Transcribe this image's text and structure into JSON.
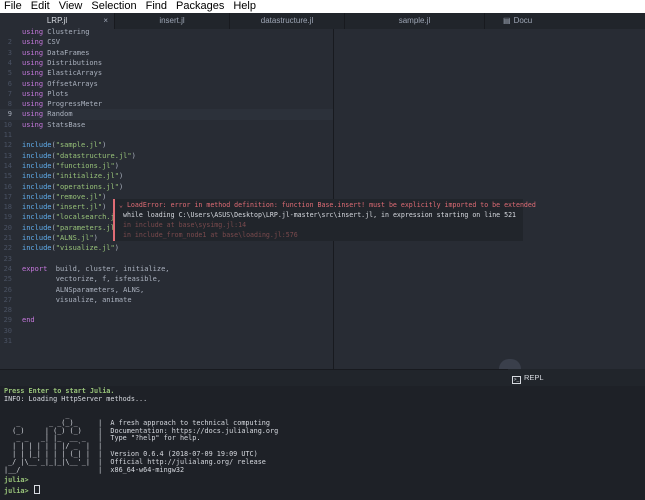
{
  "menu": [
    "File",
    "Edit",
    "View",
    "Selection",
    "Find",
    "Packages",
    "Help"
  ],
  "tabs": [
    {
      "label": "LRP.jl",
      "active": true
    },
    {
      "label": "insert.jl",
      "active": false
    },
    {
      "label": "datastructure.jl",
      "active": false
    },
    {
      "label": "sample.jl",
      "active": false
    },
    {
      "label": "Docu",
      "active": false
    }
  ],
  "close_glyph": "×",
  "editor": {
    "current_line": 9,
    "lines": [
      {
        "n": "",
        "kw": "using",
        "rest": " Clustering"
      },
      {
        "n": "2",
        "kw": "using",
        "rest": " CSV"
      },
      {
        "n": "3",
        "kw": "using",
        "rest": " DataFrames"
      },
      {
        "n": "4",
        "kw": "using",
        "rest": " Distributions"
      },
      {
        "n": "5",
        "kw": "using",
        "rest": " ElasticArrays"
      },
      {
        "n": "6",
        "kw": "using",
        "rest": " OffsetArrays"
      },
      {
        "n": "7",
        "kw": "using",
        "rest": " Plots"
      },
      {
        "n": "8",
        "kw": "using",
        "rest": " ProgressMeter"
      },
      {
        "n": "9",
        "kw": "using",
        "rest": " Random"
      },
      {
        "n": "10",
        "kw": "using",
        "rest": " StatsBase"
      },
      {
        "n": "11",
        "kw": "",
        "rest": ""
      },
      {
        "n": "12",
        "fn": "include",
        "str": "\"sample.jl\""
      },
      {
        "n": "13",
        "fn": "include",
        "str": "\"datastructure.jl\""
      },
      {
        "n": "14",
        "fn": "include",
        "str": "\"functions.jl\""
      },
      {
        "n": "15",
        "fn": "include",
        "str": "\"initialize.jl\""
      },
      {
        "n": "16",
        "fn": "include",
        "str": "\"operations.jl\""
      },
      {
        "n": "17",
        "fn": "include",
        "str": "\"remove.jl\""
      },
      {
        "n": "18",
        "fn": "include",
        "str": "\"insert.jl\""
      },
      {
        "n": "19",
        "fn": "include",
        "str": "\"localsearch.jl\""
      },
      {
        "n": "20",
        "fn": "include",
        "str": "\"parameters.jl\""
      },
      {
        "n": "21",
        "fn": "include",
        "str": "\"ALNS.jl\""
      },
      {
        "n": "22",
        "fn": "include",
        "str": "\"visualize.jl\""
      },
      {
        "n": "23",
        "kw": "",
        "rest": ""
      },
      {
        "n": "24",
        "kw": "export",
        "rest": "  build, cluster, initialize,"
      },
      {
        "n": "25",
        "kw": "",
        "rest": "        vectorize, f, isfeasible,"
      },
      {
        "n": "26",
        "kw": "",
        "rest": "        ALNSparameters, ALNS,"
      },
      {
        "n": "27",
        "kw": "",
        "rest": "        visualize, animate"
      },
      {
        "n": "28",
        "kw": "",
        "rest": ""
      },
      {
        "n": "29",
        "kw": "end",
        "rest": ""
      },
      {
        "n": "30",
        "kw": "",
        "rest": ""
      },
      {
        "n": "31",
        "kw": "",
        "rest": ""
      }
    ]
  },
  "error_popup": {
    "title": "LoadError: error in method definition: function Base.insert! must be explicitly imported to be extended",
    "detail": "while loading C:\\Users\\ASUS\\Desktop\\LRP.jl-master\\src\\insert.jl, in expression starting on line 521",
    "trace1": "in include at base\\sysimg.jl:14",
    "trace2": "in include_from_node1 at base\\loading.jl:576"
  },
  "repl_tab": {
    "label": "REPL",
    "icon": "terminal-icon"
  },
  "terminal": {
    "line1": "Press Enter to start Julia.",
    "line2": "INFO: Loading HttpServer methods...",
    "banner": [
      "               _",
      "   _       _ _(_)_     |  A fresh approach to technical computing",
      "  (_)     | (_) (_)    |  Documentation: https://docs.julialang.org",
      "   _ _   _| |_  __ _   |  Type \"?help\" for help.",
      "  | | | | | | |/ _` |  |",
      "  | | |_| | | | (_| |  |  Version 0.6.4 (2018-07-09 19:09 UTC)",
      " _/ |\\__'_|_|_|\\__'_|  |  Official http://julialang.org/ release",
      "|__/                   |  x86_64-w64-mingw32"
    ],
    "prompt1": "julia>",
    "prompt2": "julia>"
  },
  "colors": {
    "error": "#e06c75",
    "string": "#98c379",
    "keyword": "#c678dd",
    "function": "#61afef",
    "prompt": "#98c379"
  }
}
